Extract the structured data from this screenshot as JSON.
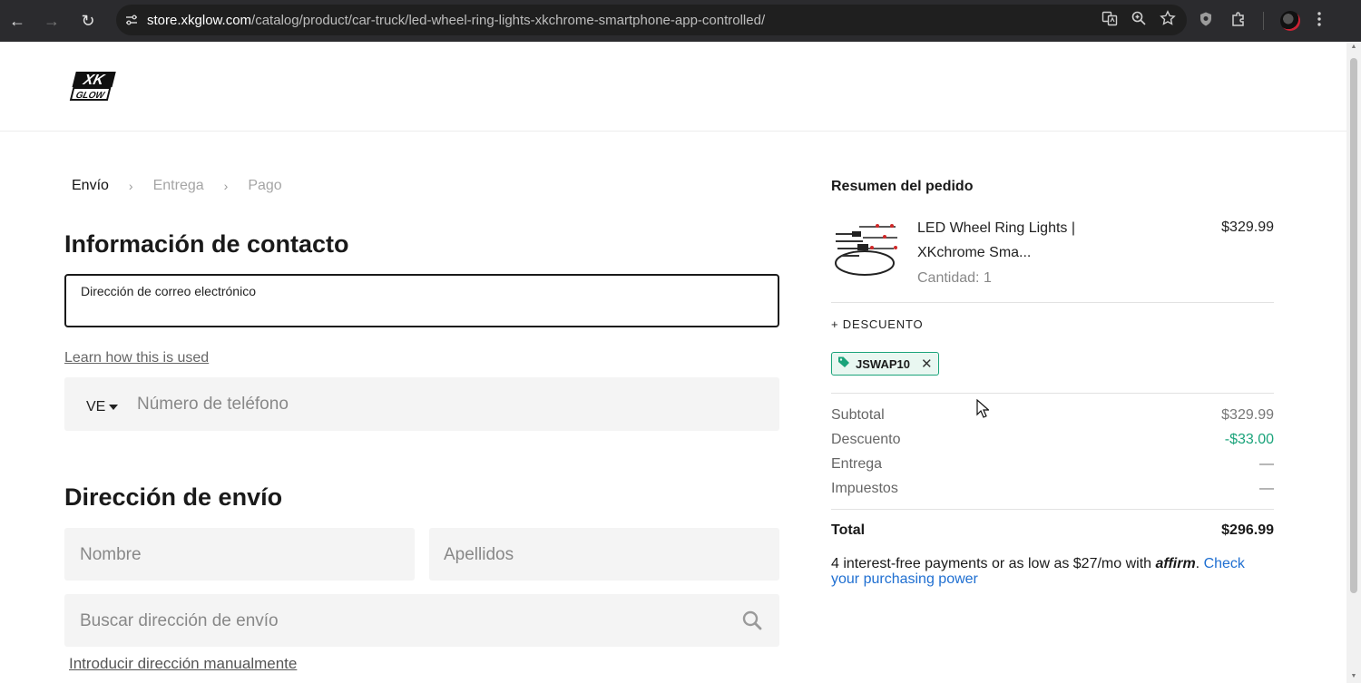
{
  "browser": {
    "url_host": "store.xkglow.com",
    "url_path": "/catalog/product/car-truck/led-wheel-ring-lights-xkchrome-smartphone-app-controlled/",
    "back": "←",
    "forward": "→",
    "reload": "↻"
  },
  "header": {
    "logo_text_top": "XK",
    "logo_text_bottom": "GLOW"
  },
  "breadcrumb": {
    "steps": [
      "Envío",
      "Entrega",
      "Pago"
    ],
    "separator": "›"
  },
  "contact": {
    "title": "Información de contacto",
    "email_label": "Dirección de correo electrónico",
    "email_value": "",
    "learn_link": "Learn how this is used",
    "phone_country": "VE",
    "phone_placeholder": "Número de teléfono"
  },
  "shipping": {
    "title": "Dirección de envío",
    "first_name_placeholder": "Nombre",
    "last_name_placeholder": "Apellidos",
    "address_search_placeholder": "Buscar dirección de envío",
    "manual_link": "Introducir dirección manualmente"
  },
  "summary": {
    "title": "Resumen del pedido",
    "product": {
      "name": "LED Wheel Ring Lights | XKchrome Sma...",
      "quantity": "Cantidad: 1",
      "price": "$329.99"
    },
    "discount_toggle": "+ DESCUENTO",
    "coupon_code": "JSWAP10",
    "coupon_remove": "✕",
    "rows": [
      {
        "label": "Subtotal",
        "value": "$329.99"
      },
      {
        "label": "Descuento",
        "value": "-$33.00"
      },
      {
        "label": "Entrega",
        "value": "—"
      },
      {
        "label": "Impuestos",
        "value": "—"
      }
    ],
    "total_label": "Total",
    "total_value": "$296.99",
    "affirm_text": "4 interest-free payments or as low as $27/mo with",
    "affirm_brand": "affirm",
    "affirm_link": "Check your purchasing power"
  },
  "colors": {
    "accent_green": "#1aa37a",
    "link_blue": "#1f6fd1",
    "chrome_bg": "#2b2b2e"
  }
}
